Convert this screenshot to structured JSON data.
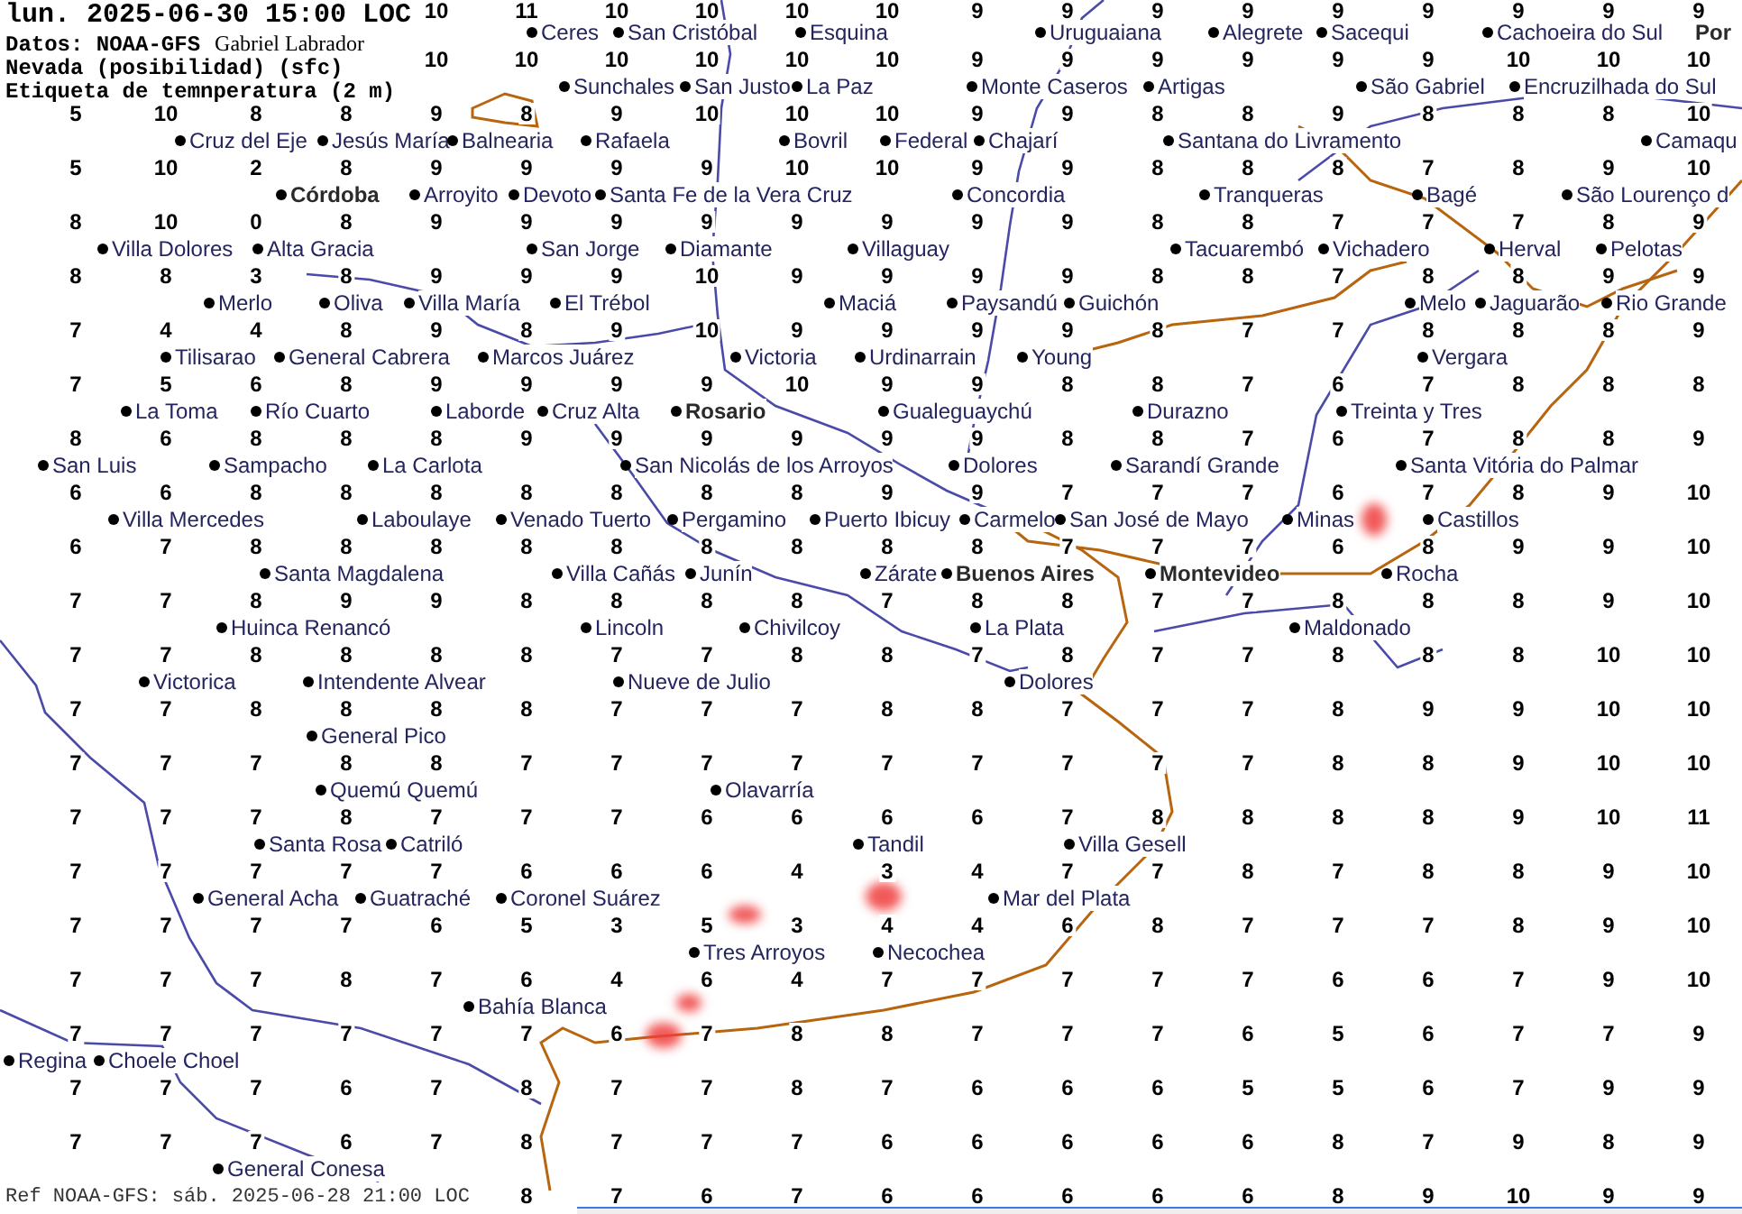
{
  "header": {
    "title": "lun. 2025-06-30 15:00 LOC",
    "source": "Datos: NOAA-GFS",
    "author": "Gabriel Labrador",
    "layer": "Nevada (posibilidad) (sfc)",
    "label_type": "Etiqueta de temnperatura (2 m)"
  },
  "map": {
    "temperature_grid": [
      [
        "10",
        "11",
        "10",
        "10",
        "10",
        "10",
        "9",
        "9",
        "9",
        "9",
        "9",
        "9",
        "9",
        "9",
        "9"
      ],
      [
        "10",
        "10",
        "10",
        "10",
        "10",
        "10",
        "9",
        "9",
        "9",
        "9",
        "9",
        "9",
        "10",
        "10",
        "10"
      ],
      [
        "5",
        "10",
        "8",
        "8",
        "9",
        "8",
        "9",
        "10",
        "10",
        "10",
        "9",
        "9",
        "8",
        "8",
        "9",
        "8",
        "8",
        "8",
        "10"
      ],
      [
        "5",
        "10",
        "2",
        "8",
        "9",
        "9",
        "9",
        "9",
        "10",
        "10",
        "9",
        "9",
        "8",
        "8",
        "8",
        "7",
        "8",
        "9",
        "10"
      ],
      [
        "8",
        "10",
        "0",
        "8",
        "9",
        "9",
        "9",
        "9",
        "9",
        "9",
        "9",
        "9",
        "8",
        "8",
        "7",
        "7",
        "7",
        "8",
        "9"
      ],
      [
        "8",
        "8",
        "3",
        "8",
        "9",
        "9",
        "9",
        "10",
        "9",
        "9",
        "9",
        "9",
        "8",
        "8",
        "7",
        "8",
        "8",
        "9",
        "9"
      ],
      [
        "7",
        "4",
        "4",
        "8",
        "9",
        "8",
        "9",
        "10",
        "9",
        "9",
        "9",
        "9",
        "8",
        "7",
        "7",
        "8",
        "8",
        "8",
        "9"
      ],
      [
        "7",
        "5",
        "6",
        "8",
        "9",
        "9",
        "9",
        "9",
        "10",
        "9",
        "9",
        "8",
        "8",
        "7",
        "6",
        "7",
        "8",
        "8",
        "8"
      ],
      [
        "8",
        "6",
        "8",
        "8",
        "8",
        "9",
        "9",
        "9",
        "9",
        "9",
        "9",
        "8",
        "8",
        "7",
        "6",
        "7",
        "8",
        "8",
        "9"
      ],
      [
        "6",
        "6",
        "8",
        "8",
        "8",
        "8",
        "8",
        "8",
        "8",
        "9",
        "9",
        "7",
        "7",
        "7",
        "6",
        "7",
        "8",
        "9",
        "10"
      ],
      [
        "6",
        "7",
        "8",
        "8",
        "8",
        "8",
        "8",
        "8",
        "8",
        "8",
        "8",
        "7",
        "7",
        "7",
        "6",
        "8",
        "9",
        "9",
        "10"
      ],
      [
        "7",
        "7",
        "8",
        "9",
        "9",
        "8",
        "8",
        "8",
        "8",
        "7",
        "8",
        "8",
        "7",
        "7",
        "8",
        "8",
        "8",
        "9",
        "10"
      ],
      [
        "7",
        "7",
        "8",
        "8",
        "8",
        "8",
        "7",
        "7",
        "8",
        "8",
        "7",
        "8",
        "7",
        "7",
        "8",
        "8",
        "8",
        "10",
        "10"
      ],
      [
        "7",
        "7",
        "8",
        "8",
        "8",
        "8",
        "7",
        "7",
        "7",
        "8",
        "8",
        "7",
        "7",
        "7",
        "8",
        "9",
        "9",
        "10",
        "10"
      ],
      [
        "7",
        "7",
        "7",
        "8",
        "8",
        "7",
        "7",
        "7",
        "7",
        "7",
        "7",
        "7",
        "7",
        "7",
        "8",
        "8",
        "9",
        "10",
        "10"
      ],
      [
        "7",
        "7",
        "7",
        "8",
        "7",
        "7",
        "7",
        "6",
        "6",
        "6",
        "6",
        "7",
        "8",
        "8",
        "8",
        "8",
        "9",
        "10",
        "11"
      ],
      [
        "7",
        "7",
        "7",
        "7",
        "7",
        "6",
        "6",
        "6",
        "4",
        "3",
        "4",
        "7",
        "7",
        "8",
        "7",
        "8",
        "8",
        "9",
        "10"
      ],
      [
        "7",
        "7",
        "7",
        "7",
        "6",
        "5",
        "3",
        "5",
        "3",
        "4",
        "4",
        "6",
        "8",
        "7",
        "7",
        "7",
        "8",
        "9",
        "10"
      ],
      [
        "7",
        "7",
        "7",
        "8",
        "7",
        "6",
        "4",
        "6",
        "4",
        "7",
        "7",
        "7",
        "7",
        "7",
        "6",
        "6",
        "7",
        "9",
        "10"
      ],
      [
        "7",
        "7",
        "7",
        "7",
        "7",
        "7",
        "6",
        "7",
        "8",
        "8",
        "7",
        "7",
        "7",
        "6",
        "5",
        "6",
        "7",
        "7",
        "9"
      ],
      [
        "7",
        "7",
        "7",
        "6",
        "7",
        "8",
        "7",
        "7",
        "8",
        "7",
        "6",
        "6",
        "6",
        "5",
        "5",
        "6",
        "7",
        "9",
        "9"
      ],
      [
        "7",
        "7",
        "7",
        "6",
        "7",
        "8",
        "7",
        "7",
        "7",
        "6",
        "6",
        "6",
        "6",
        "6",
        "8",
        "7",
        "9",
        "8",
        "9"
      ],
      [
        "8",
        "7",
        "6",
        "7",
        "6",
        "6",
        "6",
        "6",
        "6",
        "8",
        "9",
        "10",
        "9",
        "9"
      ]
    ],
    "cities": [
      {
        "name": "Ceres",
        "kind": "city"
      },
      {
        "name": "San Cristóbal",
        "kind": "city"
      },
      {
        "name": "Esquina",
        "kind": "city"
      },
      {
        "name": "Uruguaiana",
        "kind": "city"
      },
      {
        "name": "Alegrete",
        "kind": "city"
      },
      {
        "name": "Sacequi",
        "kind": "city"
      },
      {
        "name": "Cachoeira do Sul",
        "kind": "city"
      },
      {
        "name": "Por",
        "kind": "major_cut"
      },
      {
        "name": "Sunchales",
        "kind": "city"
      },
      {
        "name": "San Justo",
        "kind": "city"
      },
      {
        "name": "La Paz",
        "kind": "city"
      },
      {
        "name": "Monte Caseros",
        "kind": "city"
      },
      {
        "name": "Artigas",
        "kind": "city"
      },
      {
        "name": "São Gabriel",
        "kind": "city"
      },
      {
        "name": "Encruzilhada do Sul",
        "kind": "city"
      },
      {
        "name": "Cruz del Eje",
        "kind": "city"
      },
      {
        "name": "Jesús María",
        "kind": "city"
      },
      {
        "name": "Balnearia",
        "kind": "city"
      },
      {
        "name": "Rafaela",
        "kind": "city"
      },
      {
        "name": "Bovril",
        "kind": "city"
      },
      {
        "name": "Federal",
        "kind": "city"
      },
      {
        "name": "Chajarí",
        "kind": "city"
      },
      {
        "name": "Santana do Livramento",
        "kind": "city"
      },
      {
        "name": "Camaqu",
        "kind": "city"
      },
      {
        "name": "Córdoba",
        "kind": "major"
      },
      {
        "name": "Arroyito",
        "kind": "city"
      },
      {
        "name": "Devoto",
        "kind": "city"
      },
      {
        "name": "Santa Fe de la Vera Cruz",
        "kind": "city"
      },
      {
        "name": "Concordia",
        "kind": "city"
      },
      {
        "name": "Tranqueras",
        "kind": "city"
      },
      {
        "name": "Bagé",
        "kind": "city"
      },
      {
        "name": "São Lourenço d",
        "kind": "city"
      },
      {
        "name": "Villa Dolores",
        "kind": "city"
      },
      {
        "name": "Alta Gracia",
        "kind": "city"
      },
      {
        "name": "San Jorge",
        "kind": "city"
      },
      {
        "name": "Diamante",
        "kind": "city"
      },
      {
        "name": "Villaguay",
        "kind": "city"
      },
      {
        "name": "Tacuarembó",
        "kind": "city"
      },
      {
        "name": "Vichadero",
        "kind": "city"
      },
      {
        "name": "Herval",
        "kind": "city"
      },
      {
        "name": "Pelotas",
        "kind": "city"
      },
      {
        "name": "Merlo",
        "kind": "city"
      },
      {
        "name": "Oliva",
        "kind": "city"
      },
      {
        "name": "Villa María",
        "kind": "city"
      },
      {
        "name": "El Trébol",
        "kind": "city"
      },
      {
        "name": "Maciá",
        "kind": "city"
      },
      {
        "name": "Paysandú",
        "kind": "city"
      },
      {
        "name": "Guichón",
        "kind": "city"
      },
      {
        "name": "Melo",
        "kind": "city"
      },
      {
        "name": "Jaguarão",
        "kind": "city"
      },
      {
        "name": "Rio Grande",
        "kind": "city"
      },
      {
        "name": "Tilisarao",
        "kind": "city"
      },
      {
        "name": "General Cabrera",
        "kind": "city"
      },
      {
        "name": "Marcos Juárez",
        "kind": "city"
      },
      {
        "name": "Victoria",
        "kind": "city"
      },
      {
        "name": "Urdinarrain",
        "kind": "city"
      },
      {
        "name": "Young",
        "kind": "city"
      },
      {
        "name": "Vergara",
        "kind": "city"
      },
      {
        "name": "La Toma",
        "kind": "city"
      },
      {
        "name": "Río Cuarto",
        "kind": "city"
      },
      {
        "name": "Laborde",
        "kind": "city"
      },
      {
        "name": "Cruz Alta",
        "kind": "city"
      },
      {
        "name": "Rosario",
        "kind": "major"
      },
      {
        "name": "Gualeguaychú",
        "kind": "city"
      },
      {
        "name": "Durazno",
        "kind": "city"
      },
      {
        "name": "Treinta y Tres",
        "kind": "city"
      },
      {
        "name": "San Luis",
        "kind": "city"
      },
      {
        "name": "Sampacho",
        "kind": "city"
      },
      {
        "name": "La Carlota",
        "kind": "city"
      },
      {
        "name": "San Nicolás de los Arroyos",
        "kind": "city"
      },
      {
        "name": "Dolores",
        "kind": "city"
      },
      {
        "name": "Sarandí Grande",
        "kind": "city"
      },
      {
        "name": "Santa Vitória do Palmar",
        "kind": "city"
      },
      {
        "name": "Villa Mercedes",
        "kind": "city"
      },
      {
        "name": "Laboulaye",
        "kind": "city"
      },
      {
        "name": "Venado Tuerto",
        "kind": "city"
      },
      {
        "name": "Pergamino",
        "kind": "city"
      },
      {
        "name": "Puerto Ibicuy",
        "kind": "city"
      },
      {
        "name": "Carmelo",
        "kind": "city"
      },
      {
        "name": "San José de Mayo",
        "kind": "city"
      },
      {
        "name": "Minas",
        "kind": "city"
      },
      {
        "name": "Castillos",
        "kind": "city"
      },
      {
        "name": "Santa Magdalena",
        "kind": "city"
      },
      {
        "name": "Villa Cañás",
        "kind": "city"
      },
      {
        "name": "Junín",
        "kind": "city"
      },
      {
        "name": "Zárate",
        "kind": "city"
      },
      {
        "name": "Buenos Aires",
        "kind": "major"
      },
      {
        "name": "Montevideo",
        "kind": "major"
      },
      {
        "name": "Rocha",
        "kind": "city"
      },
      {
        "name": "Huinca Renancó",
        "kind": "city"
      },
      {
        "name": "Lincoln",
        "kind": "city"
      },
      {
        "name": "Chivilcoy",
        "kind": "city"
      },
      {
        "name": "La Plata",
        "kind": "city"
      },
      {
        "name": "Maldonado",
        "kind": "city"
      },
      {
        "name": "Victorica",
        "kind": "city"
      },
      {
        "name": "Intendente Alvear",
        "kind": "city"
      },
      {
        "name": "Nueve de Julio",
        "kind": "city"
      },
      {
        "name": "Dolores",
        "kind": "city"
      },
      {
        "name": "General Pico",
        "kind": "city"
      },
      {
        "name": "Quemú Quemú",
        "kind": "city"
      },
      {
        "name": "Olavarría",
        "kind": "city"
      },
      {
        "name": "Santa Rosa",
        "kind": "city"
      },
      {
        "name": "Catriló",
        "kind": "city"
      },
      {
        "name": "Tandil",
        "kind": "city"
      },
      {
        "name": "Villa Gesell",
        "kind": "city"
      },
      {
        "name": "General Acha",
        "kind": "city"
      },
      {
        "name": "Guatraché",
        "kind": "city"
      },
      {
        "name": "Coronel Suárez",
        "kind": "city"
      },
      {
        "name": "Mar del Plata",
        "kind": "city"
      },
      {
        "name": "Tres Arroyos",
        "kind": "city"
      },
      {
        "name": "Necochea",
        "kind": "city"
      },
      {
        "name": "Bahía Blanca",
        "kind": "city"
      },
      {
        "name": "Regina",
        "kind": "city"
      },
      {
        "name": "Choele Choel",
        "kind": "city"
      },
      {
        "name": "General Conesa",
        "kind": "city"
      }
    ]
  },
  "footer": "Ref NOAA-GFS: sáb. 2025-06-28 21:00 LOC"
}
